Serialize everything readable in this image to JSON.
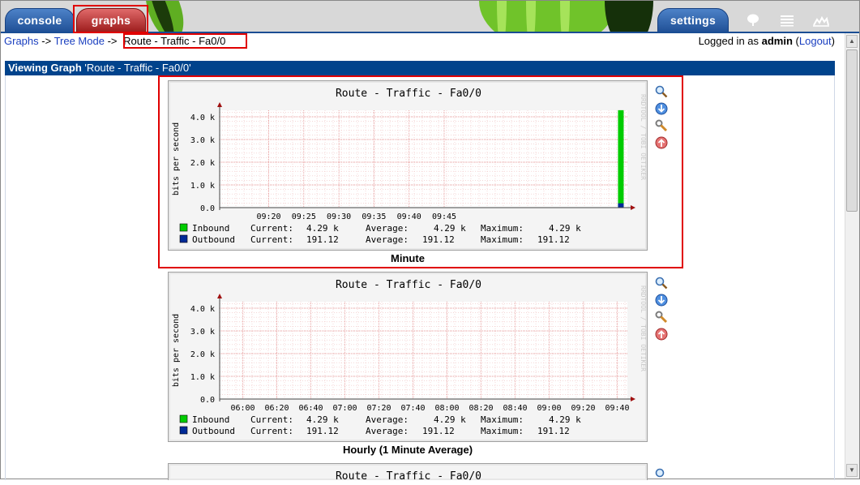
{
  "tabs": {
    "console": "console",
    "graphs": "graphs",
    "settings": "settings"
  },
  "icons": {
    "tree": "tree-icon",
    "list": "list-icon",
    "preview": "preview-icon"
  },
  "breadcrumb": {
    "graphs": "Graphs",
    "sep1": " -> ",
    "tree_mode": "Tree Mode",
    "sep2": " -> ",
    "current": "Route - Traffic - Fa0/0"
  },
  "login": {
    "prefix": "Logged in as ",
    "user": "admin",
    "open": " (",
    "logout": "Logout",
    "close": ")"
  },
  "view_header": {
    "label": "Viewing Graph",
    "name": " 'Route - Traffic - Fa0/0'"
  },
  "colors": {
    "inbound": "#00cc00",
    "outbound": "#002a97",
    "highlight": "#e00000",
    "header": "#00438c"
  },
  "graphs": [
    {
      "title": "Route - Traffic - Fa0/0",
      "ylabel": "bits per second",
      "watermark": "RRDTOOL / TOBI OETIKER",
      "yticks": [
        "4.0 k",
        "3.0 k",
        "2.0 k",
        "1.0 k",
        "0.0"
      ],
      "xticks": [
        "09:20",
        "09:25",
        "09:30",
        "09:35",
        "09:40",
        "09:45"
      ],
      "legend": [
        {
          "name": "Inbound",
          "current_label": "Current:",
          "current": "4.29 k",
          "average_label": "Average:",
          "average": "4.29 k",
          "maximum_label": "Maximum:",
          "maximum": "4.29 k"
        },
        {
          "name": "Outbound",
          "current_label": "Current:",
          "current": "191.12",
          "average_label": "Average:",
          "average": "191.12",
          "maximum_label": "Maximum:",
          "maximum": "191.12"
        }
      ],
      "caption": "Minute",
      "chart_data": {
        "type": "bar",
        "ymax": 4.29,
        "bar_position": 0.985,
        "inbound_value_k": 4.29,
        "outbound_value": 191.12
      }
    },
    {
      "title": "Route - Traffic - Fa0/0",
      "ylabel": "bits per second",
      "watermark": "RRDTOOL / TOBI OETIKER",
      "yticks": [
        "4.0 k",
        "3.0 k",
        "2.0 k",
        "1.0 k",
        "0.0"
      ],
      "xticks": [
        "06:00",
        "06:20",
        "06:40",
        "07:00",
        "07:20",
        "07:40",
        "08:00",
        "08:20",
        "08:40",
        "09:00",
        "09:20",
        "09:40"
      ],
      "legend": [
        {
          "name": "Inbound",
          "current_label": "Current:",
          "current": "4.29 k",
          "average_label": "Average:",
          "average": "4.29 k",
          "maximum_label": "Maximum:",
          "maximum": "4.29 k"
        },
        {
          "name": "Outbound",
          "current_label": "Current:",
          "current": "191.12",
          "average_label": "Average:",
          "average": "191.12",
          "maximum_label": "Maximum:",
          "maximum": "191.12"
        }
      ],
      "caption": "Hourly (1 Minute Average)"
    },
    {
      "title": "Route - Traffic - Fa0/0"
    }
  ],
  "actions": [
    "zoom-icon",
    "export-icon",
    "properties-icon",
    "top-icon"
  ]
}
